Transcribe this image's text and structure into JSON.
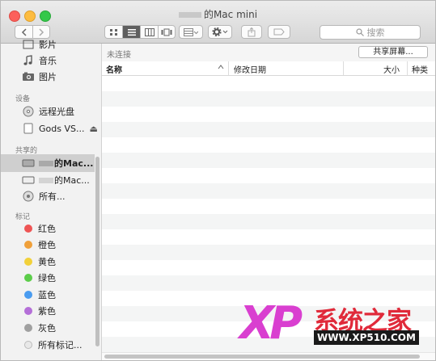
{
  "window": {
    "title": "的Mac mini"
  },
  "toolbar": {
    "search_placeholder": "搜索"
  },
  "sidebar": {
    "top_items": [
      {
        "label": "影片",
        "icon": "film-icon"
      },
      {
        "label": "音乐",
        "icon": "music-icon"
      },
      {
        "label": "图片",
        "icon": "camera-icon"
      }
    ],
    "devices_header": "设备",
    "devices": [
      {
        "label": "远程光盘",
        "icon": "disc-icon"
      },
      {
        "label": "Gods VS...",
        "icon": "drive-icon",
        "eject": "⏏"
      }
    ],
    "shared_header": "共享的",
    "shared": [
      {
        "label": "的Mac...",
        "icon": "display-icon",
        "selected": true
      },
      {
        "label": "的Mac...",
        "icon": "display-icon"
      },
      {
        "label": "所有...",
        "icon": "network-icon"
      }
    ],
    "tags_header": "标记",
    "tags": [
      {
        "label": "红色",
        "color": "#ee5454"
      },
      {
        "label": "橙色",
        "color": "#f0a03a"
      },
      {
        "label": "黄色",
        "color": "#f2d13a"
      },
      {
        "label": "绿色",
        "color": "#5ccd4a"
      },
      {
        "label": "蓝色",
        "color": "#4a9cf0"
      },
      {
        "label": "紫色",
        "color": "#b46fd8"
      },
      {
        "label": "灰色",
        "color": "#a0a0a0"
      },
      {
        "label": "所有标记...",
        "color": "#e8e8e8"
      }
    ]
  },
  "main": {
    "status": "未连接",
    "share_screen_button": "共享屏幕...",
    "columns": [
      "名称",
      "修改日期",
      "大小",
      "种类"
    ]
  },
  "watermark": {
    "logo": "XP",
    "name": "系统之家",
    "url": "WWW.XP510.COM"
  }
}
